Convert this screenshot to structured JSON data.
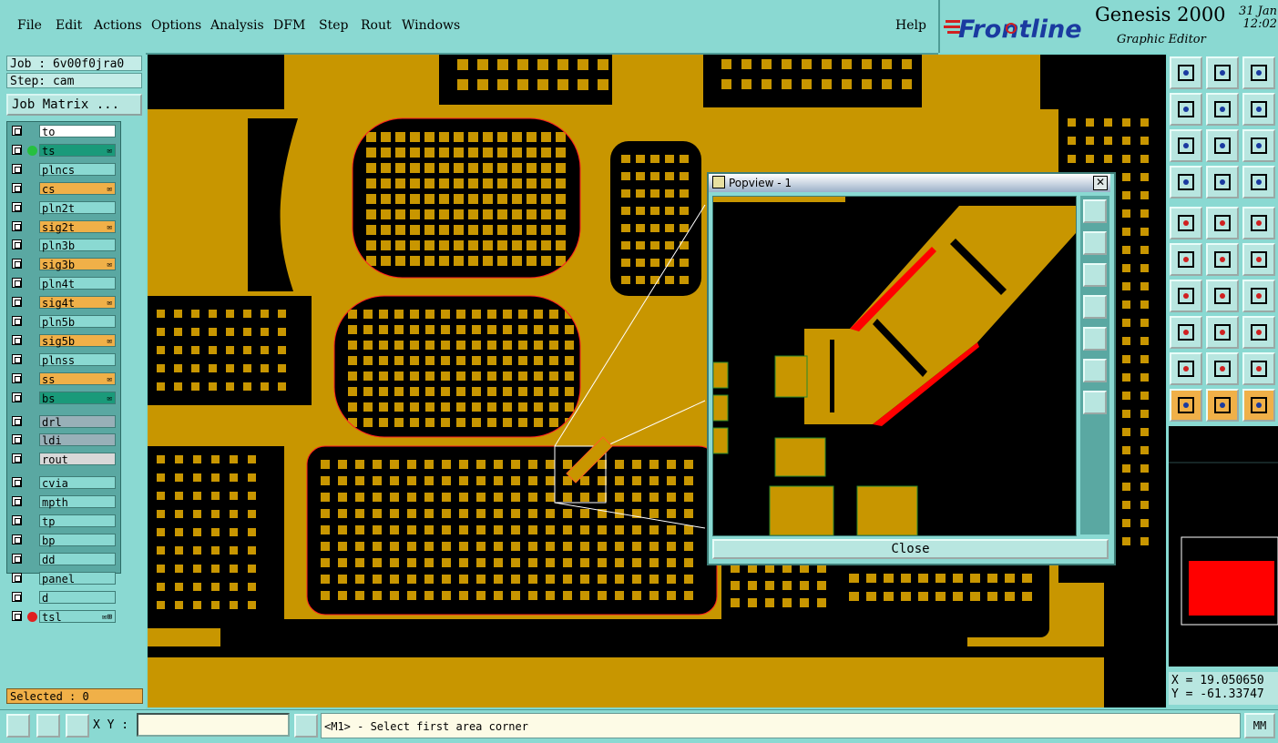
{
  "menu": {
    "items": [
      "File",
      "Edit",
      "Actions",
      "Options",
      "Analysis",
      "DFM",
      "Step",
      "Rout",
      "Windows"
    ],
    "help": "Help"
  },
  "brand": {
    "logo": "Frontline",
    "product": "Genesis 2000",
    "subtitle": "Graphic Editor",
    "date": "31 Jan",
    "time": "12:02"
  },
  "job": {
    "job_text": "Job : 6v00f0jra0",
    "step_text": "Step: cam",
    "matrix_button": "Job Matrix ..."
  },
  "layers": [
    {
      "name": "to",
      "color": "#ffffff",
      "dot": "",
      "mark": ""
    },
    {
      "name": "ts",
      "color": "#1a9a7a",
      "dot": "#26c040",
      "mark": "✉"
    },
    {
      "name": "plncs",
      "color": "#8ad9d2",
      "dot": "",
      "mark": ""
    },
    {
      "name": "cs",
      "color": "#f0b048",
      "dot": "",
      "mark": "✉"
    },
    {
      "name": "pln2t",
      "color": "#8ad9d2",
      "dot": "",
      "mark": ""
    },
    {
      "name": "sig2t",
      "color": "#f0b048",
      "dot": "",
      "mark": "✉"
    },
    {
      "name": "pln3b",
      "color": "#8ad9d2",
      "dot": "",
      "mark": ""
    },
    {
      "name": "sig3b",
      "color": "#f0b048",
      "dot": "",
      "mark": "✉"
    },
    {
      "name": "pln4t",
      "color": "#8ad9d2",
      "dot": "",
      "mark": ""
    },
    {
      "name": "sig4t",
      "color": "#f0b048",
      "dot": "",
      "mark": "✉"
    },
    {
      "name": "pln5b",
      "color": "#8ad9d2",
      "dot": "",
      "mark": ""
    },
    {
      "name": "sig5b",
      "color": "#f0b048",
      "dot": "",
      "mark": "✉"
    },
    {
      "name": "plnss",
      "color": "#8ad9d2",
      "dot": "",
      "mark": ""
    },
    {
      "name": "ss",
      "color": "#f0b048",
      "dot": "",
      "mark": "✉"
    },
    {
      "name": "bs",
      "color": "#1a9a7a",
      "dot": "",
      "mark": "✉"
    },
    {
      "name": "drl",
      "color": "#98b0b8",
      "dot": "",
      "mark": ""
    },
    {
      "name": "ldi",
      "color": "#98b0b8",
      "dot": "",
      "mark": ""
    },
    {
      "name": "rout",
      "color": "#d8d8d8",
      "dot": "",
      "mark": ""
    },
    {
      "name": "cvia",
      "color": "#8ad9d2",
      "dot": "",
      "mark": ""
    },
    {
      "name": "mpth",
      "color": "#8ad9d2",
      "dot": "",
      "mark": ""
    },
    {
      "name": "tp",
      "color": "#8ad9d2",
      "dot": "",
      "mark": ""
    },
    {
      "name": "bp",
      "color": "#8ad9d2",
      "dot": "",
      "mark": ""
    },
    {
      "name": "dd",
      "color": "#8ad9d2",
      "dot": "",
      "mark": ""
    },
    {
      "name": "panel",
      "color": "#8ad9d2",
      "dot": "",
      "mark": ""
    },
    {
      "name": "d",
      "color": "#8ad9d2",
      "dot": "",
      "mark": ""
    },
    {
      "name": "tsl",
      "color": "#8ad9d2",
      "dot": "#e02020",
      "mark": "✉⊞"
    }
  ],
  "selected_text": "Selected : 0",
  "popview": {
    "title": "Popview - 1",
    "close_label": "Close"
  },
  "coords": {
    "x_text": "X = 19.050650",
    "y_text": "Y = -61.33747"
  },
  "status": {
    "xy_label": "X Y :",
    "xy_value": "",
    "message": "<M1> - Select first area corner",
    "units": "MM"
  },
  "colors": {
    "copper": "#c89600",
    "board_bg": "#000000",
    "panel": "#8ad9d2",
    "highlight": "#ff0000"
  }
}
